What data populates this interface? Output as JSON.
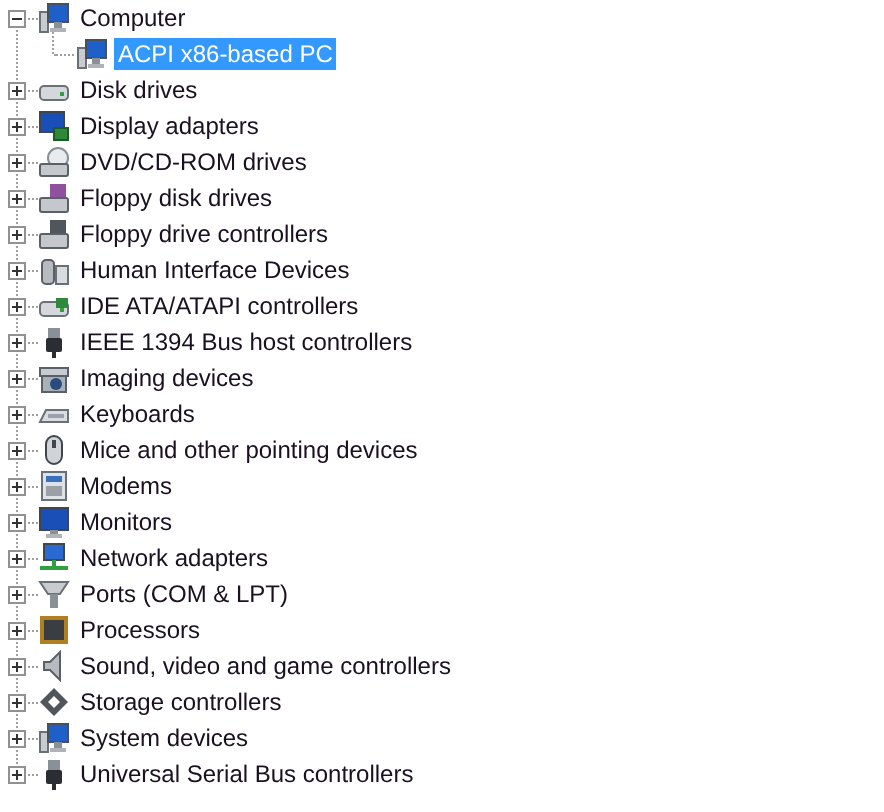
{
  "tree": [
    {
      "label": "Computer",
      "kind": "computer",
      "expanded": true,
      "selected": false,
      "children": [
        {
          "label": "ACPI x86-based PC",
          "kind": "computer",
          "selected": true
        }
      ]
    },
    {
      "label": "Disk drives",
      "kind": "disk",
      "expanded": false,
      "selected": false
    },
    {
      "label": "Display adapters",
      "kind": "display",
      "expanded": false,
      "selected": false
    },
    {
      "label": "DVD/CD-ROM drives",
      "kind": "optical",
      "expanded": false,
      "selected": false
    },
    {
      "label": "Floppy disk drives",
      "kind": "floppy",
      "expanded": false,
      "selected": false
    },
    {
      "label": "Floppy drive controllers",
      "kind": "floppyctl",
      "expanded": false,
      "selected": false
    },
    {
      "label": "Human Interface Devices",
      "kind": "hid",
      "expanded": false,
      "selected": false
    },
    {
      "label": "IDE ATA/ATAPI controllers",
      "kind": "ide",
      "expanded": false,
      "selected": false
    },
    {
      "label": "IEEE 1394 Bus host controllers",
      "kind": "plug",
      "expanded": false,
      "selected": false
    },
    {
      "label": "Imaging devices",
      "kind": "camera",
      "expanded": false,
      "selected": false
    },
    {
      "label": "Keyboards",
      "kind": "keyboard",
      "expanded": false,
      "selected": false
    },
    {
      "label": "Mice and other pointing devices",
      "kind": "mouse",
      "expanded": false,
      "selected": false
    },
    {
      "label": "Modems",
      "kind": "modem",
      "expanded": false,
      "selected": false
    },
    {
      "label": "Monitors",
      "kind": "monitor",
      "expanded": false,
      "selected": false
    },
    {
      "label": "Network adapters",
      "kind": "network",
      "expanded": false,
      "selected": false
    },
    {
      "label": "Ports (COM & LPT)",
      "kind": "port",
      "expanded": false,
      "selected": false
    },
    {
      "label": "Processors",
      "kind": "chip",
      "expanded": false,
      "selected": false
    },
    {
      "label": "Sound, video and game controllers",
      "kind": "speaker",
      "expanded": false,
      "selected": false
    },
    {
      "label": "Storage controllers",
      "kind": "storage",
      "expanded": false,
      "selected": false
    },
    {
      "label": "System devices",
      "kind": "system",
      "expanded": false,
      "selected": false
    },
    {
      "label": "Universal Serial Bus controllers",
      "kind": "plug",
      "expanded": false,
      "selected": false
    }
  ]
}
